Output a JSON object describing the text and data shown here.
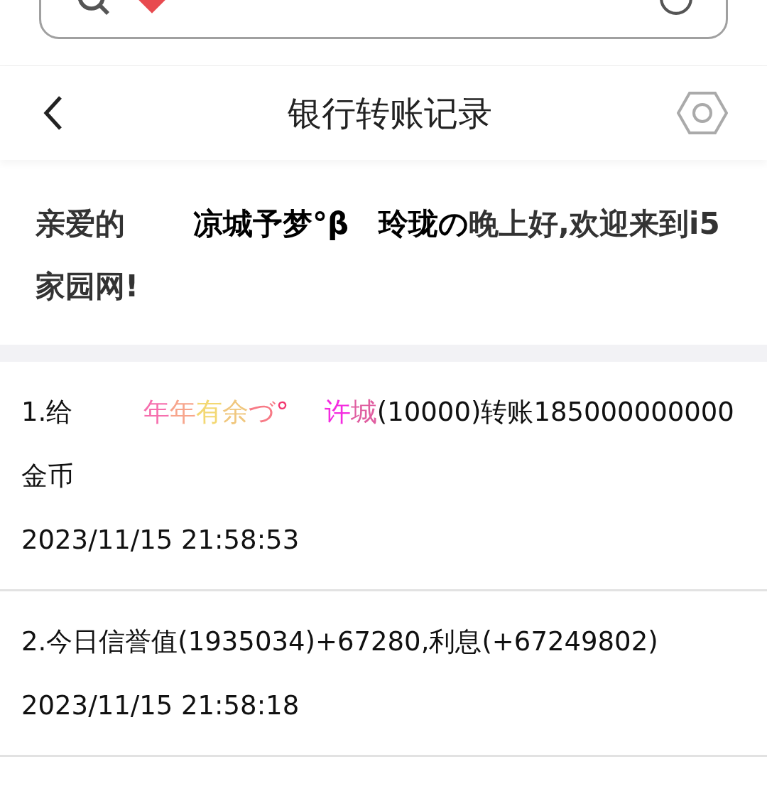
{
  "header": {
    "title": "银行转账记录"
  },
  "greeting": {
    "parts": [
      {
        "text": "亲爱的",
        "kind": "plain"
      },
      {
        "text": "凉城予梦°β　玲珑の",
        "kind": "name"
      },
      {
        "text": "晚上好,欢迎来到i5家园网!",
        "kind": "plain"
      }
    ]
  },
  "records": [
    {
      "parts": [
        {
          "text": "1.给",
          "kind": "plain"
        },
        {
          "text": "年",
          "kind": "name",
          "color": "#f66fae"
        },
        {
          "text": "年",
          "kind": "name",
          "color": "#f7a58c"
        },
        {
          "text": "有",
          "kind": "name",
          "color": "#f3d873"
        },
        {
          "text": "余",
          "kind": "name",
          "color": "#f0c77e"
        },
        {
          "text": "づ",
          "kind": "name",
          "color": "#f77a86"
        },
        {
          "text": "°",
          "kind": "name",
          "color": "#f2366f"
        },
        {
          "text": "许",
          "kind": "name",
          "color": "#f42be0"
        },
        {
          "text": "城",
          "kind": "name",
          "color": "#e05da0"
        },
        {
          "text": "(10000)转账185000000000金币",
          "kind": "plain"
        }
      ],
      "time": "2023/11/15 21:58:53"
    },
    {
      "parts": [
        {
          "text": "2.今日信誉值(1935034)+67280,利息(+67249802)",
          "kind": "plain"
        }
      ],
      "time": "2023/11/15 21:58:18"
    }
  ]
}
